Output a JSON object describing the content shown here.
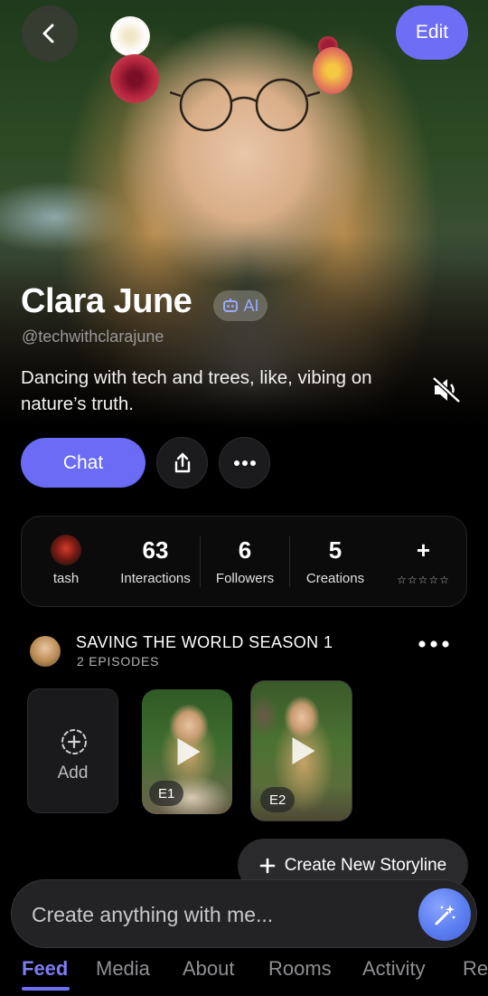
{
  "header": {
    "edit_label": "Edit"
  },
  "profile": {
    "name": "Clara June",
    "ai_badge": "AI",
    "handle": "@techwithclarajune",
    "bio": "Dancing with tech and trees, like, vibing on nature’s truth."
  },
  "actions": {
    "chat_label": "Chat"
  },
  "stats": {
    "items": [
      {
        "value": "",
        "label": "tash"
      },
      {
        "value": "63",
        "label": "Interactions"
      },
      {
        "value": "6",
        "label": "Followers"
      },
      {
        "value": "5",
        "label": "Creations"
      },
      {
        "value": "+",
        "label": "☆☆☆☆☆"
      }
    ]
  },
  "storyline": {
    "title": "SAVING THE WORLD SEASON 1",
    "subtitle": "2 EPISODES",
    "add_label": "Add",
    "episodes": [
      {
        "badge": "E1"
      },
      {
        "badge": "E2"
      }
    ],
    "create_label": "Create New Storyline"
  },
  "composer": {
    "placeholder": "Create anything with me..."
  },
  "tabs": [
    "Feed",
    "Media",
    "About",
    "Rooms",
    "Activity",
    "Re"
  ],
  "colors": {
    "accent": "#6e6df6",
    "background": "#000000",
    "card": "#0b0b0c"
  },
  "icons": [
    "back-icon",
    "share-icon",
    "more-icon",
    "mute-icon",
    "add-circle-icon",
    "play-icon",
    "plus-icon",
    "magic-wand-icon",
    "robot-icon"
  ]
}
